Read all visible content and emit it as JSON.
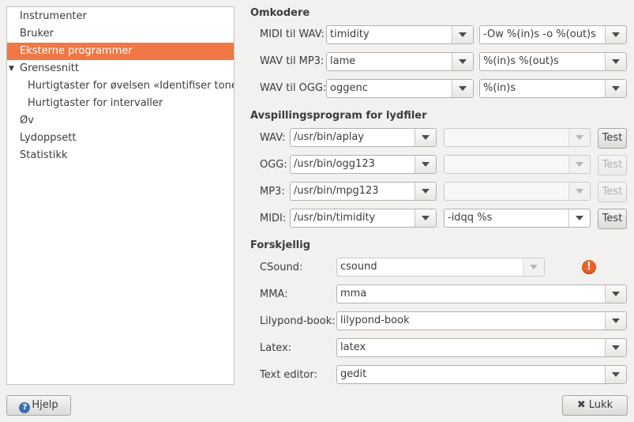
{
  "sidebar": {
    "items": [
      {
        "label": "Instrumenter"
      },
      {
        "label": "Bruker"
      },
      {
        "label": "Eksterne programmer"
      },
      {
        "label": "Grensesnitt"
      },
      {
        "label": "Hurtigtaster for øvelsen «Identifiser tone»"
      },
      {
        "label": "Hurtigtaster for intervaller"
      },
      {
        "label": "Øv"
      },
      {
        "label": "Lydoppsett"
      },
      {
        "label": "Statistikk"
      }
    ],
    "selected": "Eksterne programmer",
    "selected_color": "#f07746"
  },
  "omkodere": {
    "heading": "Omkodere",
    "rows": [
      {
        "label": "MIDI til WAV:",
        "program": "timidity",
        "args": "-Ow %(in)s -o %(out)s"
      },
      {
        "label": "WAV til MP3:",
        "program": "lame",
        "args": "%(in)s %(out)s"
      },
      {
        "label": "WAV til OGG:",
        "program": "oggenc",
        "args": "%(in)s"
      }
    ]
  },
  "avspilling": {
    "heading": "Avspillingsprogram for lydfiler",
    "test_label": "Test",
    "rows": [
      {
        "label": "WAV:",
        "program": "/usr/bin/aplay",
        "args": "",
        "test_enabled": true
      },
      {
        "label": "OGG:",
        "program": "/usr/bin/ogg123",
        "args": "",
        "test_enabled": false
      },
      {
        "label": "MP3:",
        "program": "/usr/bin/mpg123",
        "args": "",
        "test_enabled": false
      },
      {
        "label": "MIDI:",
        "program": "/usr/bin/timidity",
        "args": "-idqq %s",
        "test_enabled": true
      }
    ]
  },
  "forskjellig": {
    "heading": "Forskjellig",
    "rows": [
      {
        "label": "CSound:",
        "value": "csound",
        "warning_icon": "warning-icon"
      },
      {
        "label": "MMA:",
        "value": "mma"
      },
      {
        "label": "Lilypond-book:",
        "value": "lilypond-book"
      },
      {
        "label": "Latex:",
        "value": "latex"
      },
      {
        "label": "Text editor:",
        "value": "gedit"
      }
    ]
  },
  "buttons": {
    "help": "Hjelp",
    "close": "Lukk"
  }
}
